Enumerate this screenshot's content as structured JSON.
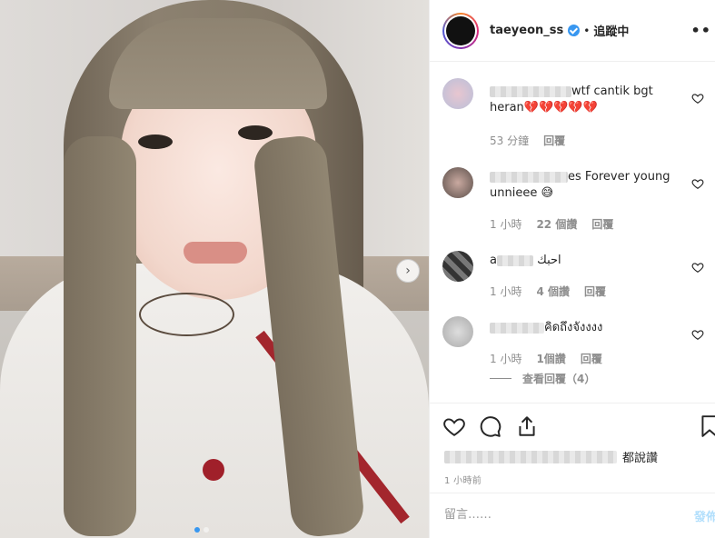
{
  "post": {
    "carousel_next": "›"
  },
  "header": {
    "username": "taeyeon_ss",
    "separator": "•",
    "following": "追蹤中",
    "more": "••"
  },
  "comments": [
    {
      "name_visible": "",
      "text": "wtf cantik bgt heran💔💔💔💔💔",
      "time": "53 分鐘",
      "replies": "",
      "reply": "回覆"
    },
    {
      "name_visible": "",
      "text": "es Forever young unnieee 😅",
      "time": "1 小時",
      "replies": "22 個讚",
      "reply": "回覆"
    },
    {
      "name_visible": "a",
      "text": "احبك",
      "time": "1 小時",
      "replies": "4 個讚",
      "reply": "回覆"
    },
    {
      "name_visible": "",
      "text": "คิดถึงจังงงง",
      "time": "1 小時",
      "replies": "1個讚",
      "reply": "回覆"
    }
  ],
  "view_replies": "查看回覆（4）",
  "likes": {
    "suffix": "都說讚"
  },
  "time_ago": "1 小時前",
  "add_comment": {
    "placeholder": "留言……",
    "post_label": "發佈"
  },
  "colors": {
    "accent": "#3897f0",
    "post_disabled": "#b2dffc"
  }
}
